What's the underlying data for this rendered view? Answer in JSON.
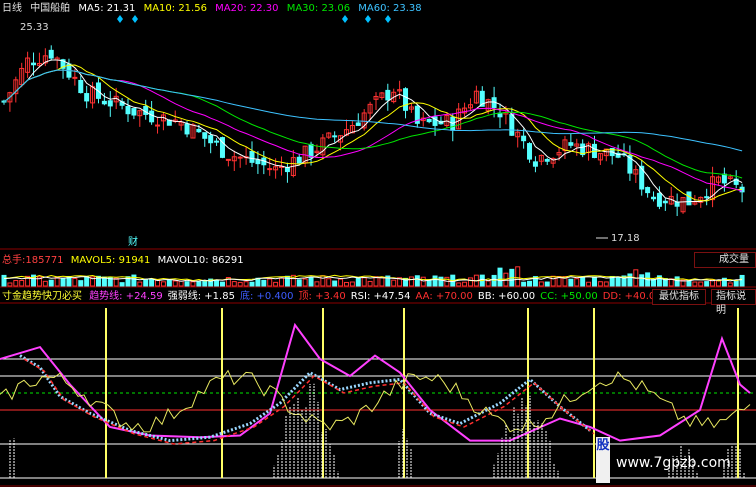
{
  "colors": {
    "bg": "#000000",
    "grid": "#8b0000",
    "up": "#ff3232",
    "down": "#54ffff",
    "ma5": "#ffffff",
    "ma10": "#ffff00",
    "ma20": "#ff00ff",
    "ma30": "#00e600",
    "ma60": "#3dc2ff",
    "magenta": "#ff40ff",
    "white": "#ffffff",
    "yellow": "#ffff66",
    "accent": "#00c0ff"
  },
  "header": {
    "period": "日线",
    "stock": "中国船舶",
    "ma5": "MA5: 21.31",
    "ma10": "MA10: 21.56",
    "ma20": "MA20: 22.30",
    "ma30": "MA30: 23.06",
    "ma60": "MA60: 23.38"
  },
  "price_chart": {
    "high_label": "25.33",
    "low_label": "17.18",
    "event_badge": "财",
    "ylim": [
      16.5,
      26.6
    ],
    "bars": 126
  },
  "volume": {
    "total_label": "总手:",
    "total_value": "185771",
    "vmavol5": "MAVOL5: 91941",
    "vmavol10": "MAVOL10: 86291",
    "button": "成交量"
  },
  "indicator": {
    "name": "寸金趋势快刀必买",
    "items": [
      {
        "label": "趋势线:",
        "value": "+24.59",
        "color": "#ff40ff"
      },
      {
        "label": "强弱线:",
        "value": "+1.85",
        "color": "#ffffff"
      },
      {
        "label": "底:",
        "value": "+0.400",
        "color": "#3d5cff"
      },
      {
        "label": "顶:",
        "value": "+3.40",
        "color": "#ff3030"
      },
      {
        "label": "RSI:",
        "value": "+47.54",
        "color": "#ffffff"
      },
      {
        "label": "AA:",
        "value": "+70.00",
        "color": "#ff3030"
      },
      {
        "label": "BB:",
        "value": "+60.00",
        "color": "#ffffff"
      },
      {
        "label": "CC:",
        "value": "+50.00",
        "color": "#00e600"
      },
      {
        "label": "DD:",
        "value": "+40.00",
        "color": "#ff3030"
      },
      {
        "label": "F",
        "value": "",
        "color": "#ffffff"
      }
    ],
    "btn_best": "最优指标",
    "btn_help": "指标说明",
    "levels": [
      70,
      60,
      50,
      40,
      20,
      0
    ]
  },
  "watermark": {
    "url": "www.7gpzb.com",
    "badge": "股"
  }
}
